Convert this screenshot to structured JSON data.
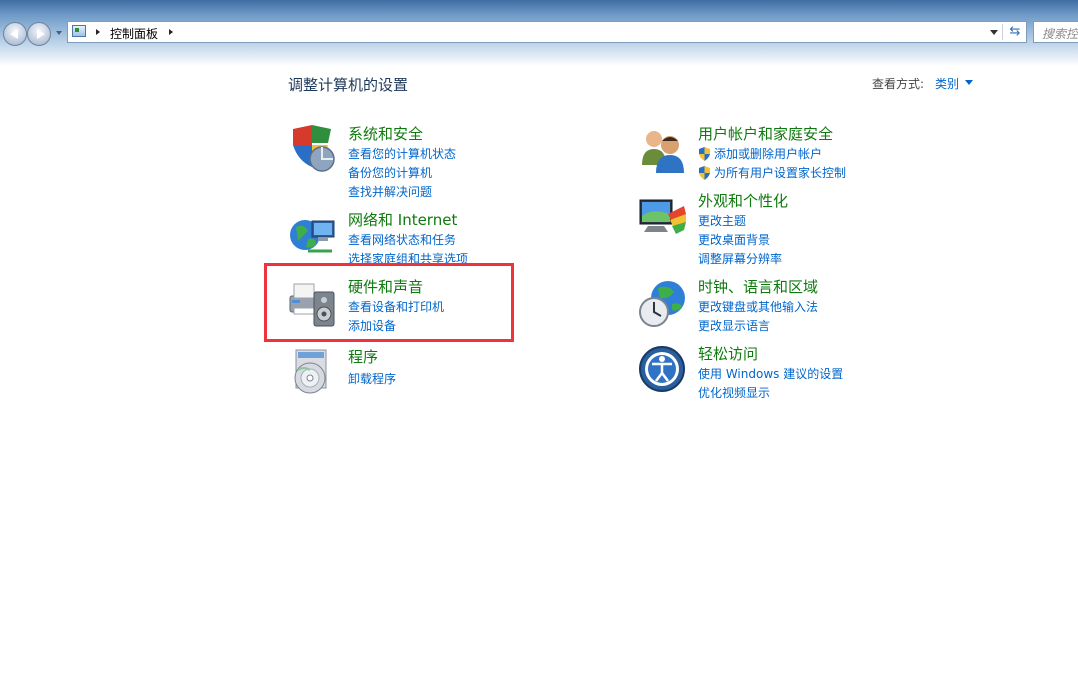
{
  "navigation": {
    "breadcrumb": [
      "控制面板"
    ],
    "search_placeholder": "搜索控"
  },
  "header": {
    "page_title": "调整计算机的设置",
    "view_by_label": "查看方式:",
    "view_by_value": "类别"
  },
  "categories": [
    {
      "title": "系统和安全",
      "icon": "shield-globe-icon",
      "links": [
        "查看您的计算机状态",
        "备份您的计算机",
        "查找并解决问题"
      ]
    },
    {
      "title": "网络和 Internet",
      "icon": "network-globe-icon",
      "links": [
        "查看网络状态和任务",
        "选择家庭组和共享选项"
      ]
    },
    {
      "title": "硬件和声音",
      "icon": "printer-speaker-icon",
      "links": [
        "查看设备和打印机",
        "添加设备"
      ]
    },
    {
      "title": "程序",
      "icon": "program-disc-icon",
      "links": [
        "卸载程序"
      ]
    },
    {
      "title": "用户帐户和家庭安全",
      "icon": "users-icon",
      "links": [
        "添加或删除用户帐户",
        "为所有用户设置家长控制"
      ]
    },
    {
      "title": "外观和个性化",
      "icon": "monitor-palette-icon",
      "links": [
        "更改主题",
        "更改桌面背景",
        "调整屏幕分辨率"
      ]
    },
    {
      "title": "时钟、语言和区域",
      "icon": "clock-globe-icon",
      "links": [
        "更改键盘或其他输入法",
        "更改显示语言"
      ]
    },
    {
      "title": "轻松访问",
      "icon": "ease-of-access-icon",
      "links": [
        "使用 Windows 建议的设置",
        "优化视频显示"
      ]
    }
  ],
  "colors": {
    "category_title": "#0e7a0d",
    "link": "#0066cc",
    "highlight_border": "#f0323c"
  }
}
